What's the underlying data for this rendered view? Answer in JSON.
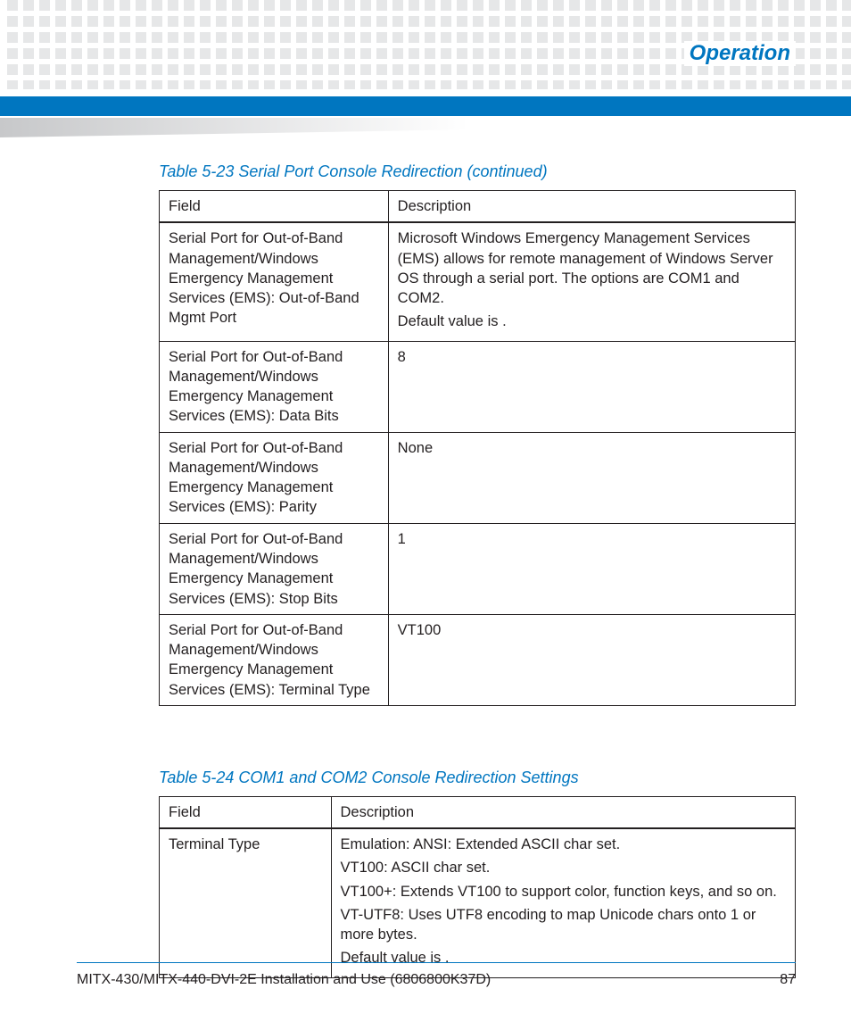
{
  "header": {
    "section": "Operation"
  },
  "table1": {
    "caption": "Table 5-23 Serial Port Console Redirection (continued)",
    "headers": {
      "field": "Field",
      "desc": "Description"
    },
    "rows": [
      {
        "field": "Serial Port for Out-of-Band Management/Windows Emergency Management Services (EMS): Out-of-Band Mgmt Port",
        "desc": [
          "Microsoft Windows Emergency Management Services (EMS) allows for remote management of Windows Server OS through a serial port. The options are COM1 and COM2.",
          "Default value is            ."
        ]
      },
      {
        "field": "Serial Port for Out-of-Band Management/Windows Emergency Management Services (EMS): Data Bits",
        "desc": [
          "8"
        ]
      },
      {
        "field": "Serial Port for Out-of-Band Management/Windows Emergency Management Services (EMS): Parity",
        "desc": [
          "None"
        ]
      },
      {
        "field": "Serial Port for Out-of-Band Management/Windows Emergency Management Services (EMS): Stop Bits",
        "desc": [
          "1"
        ]
      },
      {
        "field": "Serial Port for Out-of-Band Management/Windows Emergency Management Services (EMS): Terminal Type",
        "desc": [
          "VT100"
        ]
      }
    ]
  },
  "table2": {
    "caption": "Table 5-24 COM1 and COM2 Console Redirection Settings",
    "headers": {
      "field": "Field",
      "desc": "Description"
    },
    "rows": [
      {
        "field": "Terminal Type",
        "desc": [
          "Emulation: ANSI: Extended ASCII char set.",
          "VT100: ASCII char set.",
          "VT100+: Extends VT100 to support color, function keys, and so on.",
          "VT-UTF8: Uses UTF8 encoding to map Unicode chars onto 1 or more bytes.",
          "Default value is              ."
        ]
      }
    ]
  },
  "footer": {
    "doc_title": "MITX-430/MITX-440-DVI-2E Installation and Use (6806800K37D)",
    "page": "87"
  }
}
